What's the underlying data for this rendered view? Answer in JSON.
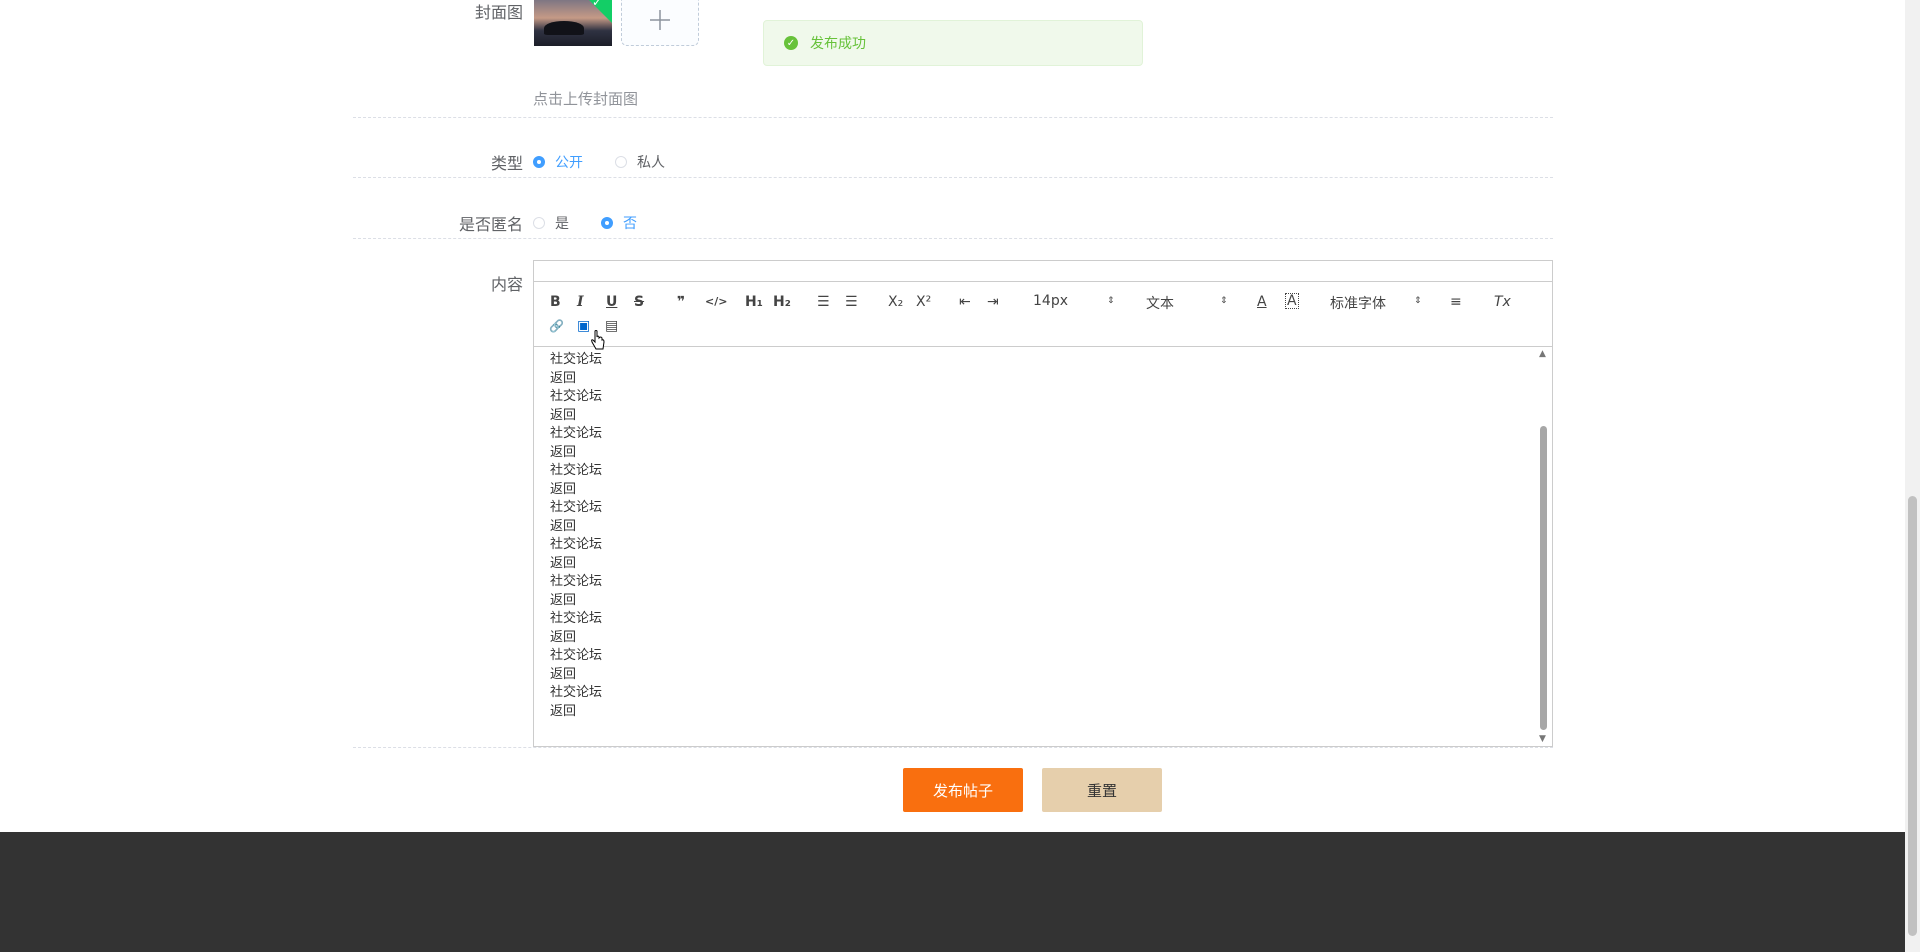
{
  "labels": {
    "cover": "封面图",
    "type": "类型",
    "anonymous": "是否匿名",
    "content": "内容"
  },
  "cover": {
    "tip": "点击上传封面图",
    "uploaded_check": "✓",
    "add_glyph": "+"
  },
  "toast": {
    "icon": "✓",
    "message": "发布成功"
  },
  "type_options": [
    {
      "label": "公开",
      "checked": true
    },
    {
      "label": "私人",
      "checked": false
    }
  ],
  "anonymous_options": [
    {
      "label": "是",
      "checked": false
    },
    {
      "label": "否",
      "checked": true
    }
  ],
  "toolbar": {
    "bold": "B",
    "italic": "I",
    "underline": "U",
    "strike": "S",
    "quote": "❞",
    "code": "</>",
    "h1": "H₁",
    "h2": "H₂",
    "ordered_list": "☰",
    "bullet_list": "☰",
    "subscript": "X₂",
    "superscript": "X²",
    "outdent": "⇤",
    "indent": "⇥",
    "font_size": "14px",
    "header_select": "文本",
    "color": "A",
    "background": "A",
    "font_family": "标准字体",
    "align": "≡",
    "clean": "Tx",
    "link": "🔗",
    "image": "▣",
    "video": "▤",
    "select_arrow": "⇕"
  },
  "content_lines": [
    "社交论坛",
    "返回",
    "社交论坛",
    "返回",
    "社交论坛",
    "返回",
    "社交论坛",
    "返回",
    "社交论坛",
    "返回",
    "社交论坛",
    "返回",
    "社交论坛",
    "返回",
    "社交论坛",
    "返回",
    "社交论坛",
    "返回",
    "社交论坛",
    "返回"
  ],
  "scroll": {
    "up": "▲",
    "down": "▼"
  },
  "buttons": {
    "publish": "发布帖子",
    "reset": "重置"
  },
  "colors": {
    "accent": "#409eff",
    "success": "#67c23a",
    "publish_bg": "#f96f0f",
    "reset_bg": "#e6cfac",
    "footer_bg": "#333333"
  }
}
